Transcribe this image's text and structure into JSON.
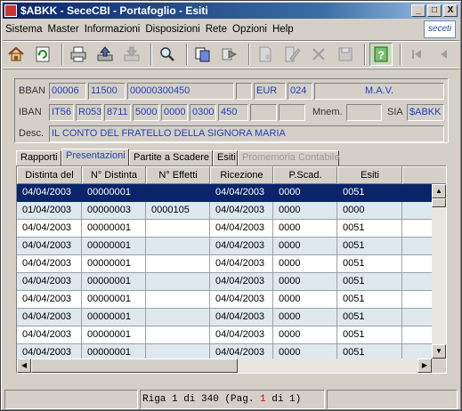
{
  "window": {
    "title": "$ABKK - SeceCBI - Portafoglio - Esiti",
    "controls": [
      "_",
      "□",
      "X"
    ]
  },
  "menu": [
    "Sistema",
    "Master",
    "Informazioni",
    "Disposizioni",
    "Rete",
    "Opzioni",
    "Help"
  ],
  "logo_text": "seceti",
  "toolbar": [
    "home-icon",
    "refresh-icon",
    "print-icon",
    "export-icon",
    "import-icon",
    "search-icon",
    "copy-icon",
    "forward-icon",
    "new-doc-icon",
    "edit-doc-icon",
    "delete-icon",
    "save-icon",
    "help-icon",
    "first-icon",
    "prev-icon"
  ],
  "info": {
    "bban_label": "BBAN",
    "bban": {
      "abi": "00006",
      "cab": "11500",
      "conto": "00000300450",
      "blank": "",
      "currency": "EUR",
      "code": "024",
      "type": "M.A.V."
    },
    "iban_label": "IBAN",
    "iban": [
      "IT56",
      "R053",
      "8711",
      "5000",
      "0000",
      "0300",
      "450",
      "",
      ""
    ],
    "mnem_label": "Mnem.",
    "mnem": "",
    "sia_label": "SIA",
    "sia": "$ABKK",
    "desc_label": "Desc.",
    "desc": "IL CONTO DEL FRATELLO DELLA SIGNORA MARIA"
  },
  "tabs": [
    {
      "label": "Rapporti",
      "active": false,
      "disabled": false
    },
    {
      "label": "Presentazioni",
      "active": true,
      "disabled": false
    },
    {
      "label": "Partite a Scadere",
      "active": false,
      "disabled": false
    },
    {
      "label": "Esiti",
      "active": false,
      "disabled": false
    },
    {
      "label": "Promemoria Contabile",
      "active": false,
      "disabled": true
    }
  ],
  "grid": {
    "columns": [
      "Distinta del",
      "N° Distinta",
      "N° Effetti",
      "Ricezione",
      "P.Scad.",
      "Esiti"
    ],
    "rows": [
      [
        "04/04/2003",
        "00000001",
        "",
        "04/04/2003",
        "0000",
        "0051"
      ],
      [
        "01/04/2003",
        "00000003",
        "0000105",
        "04/04/2003",
        "0000",
        "0000"
      ],
      [
        "04/04/2003",
        "00000001",
        "",
        "04/04/2003",
        "0000",
        "0051"
      ],
      [
        "04/04/2003",
        "00000001",
        "",
        "04/04/2003",
        "0000",
        "0051"
      ],
      [
        "04/04/2003",
        "00000001",
        "",
        "04/04/2003",
        "0000",
        "0051"
      ],
      [
        "04/04/2003",
        "00000001",
        "",
        "04/04/2003",
        "0000",
        "0051"
      ],
      [
        "04/04/2003",
        "00000001",
        "",
        "04/04/2003",
        "0000",
        "0051"
      ],
      [
        "04/04/2003",
        "00000001",
        "",
        "04/04/2003",
        "0000",
        "0051"
      ],
      [
        "04/04/2003",
        "00000001",
        "",
        "04/04/2003",
        "0000",
        "0051"
      ],
      [
        "04/04/2003",
        "00000001",
        "",
        "04/04/2003",
        "0000",
        "0051"
      ]
    ],
    "selected_row": 0
  },
  "status": {
    "prefix": "Riga 1 di 340  (Pag. ",
    "page": "1",
    "suffix": " di 1)"
  }
}
